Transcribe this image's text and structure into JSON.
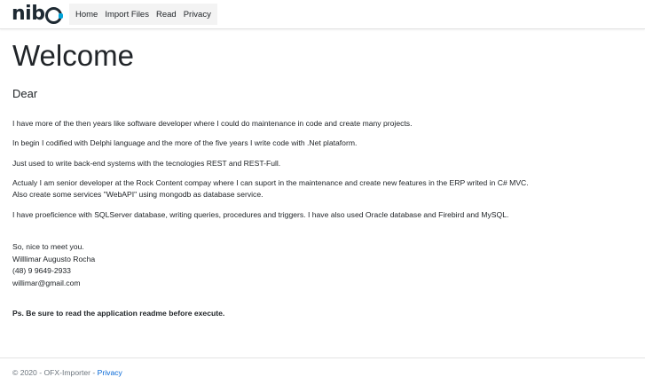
{
  "nav": {
    "brand": "nib",
    "links": [
      "Home",
      "Import Files",
      "Read",
      "Privacy"
    ]
  },
  "main": {
    "title": "Welcome",
    "greeting": "Dear",
    "paragraphs": [
      "I have more of the then years like software developer where I could do maintenance in code and create many projects.",
      "In begin I codified with Delphi language and the more of the five years I write code with .Net plataform.",
      "Just used to write back-end systems with the tecnologies REST and REST-Full.",
      "Actualy I am senior developer at the Rock Content compay where I can suport in the maintenance and create new features in the ERP writed in C# MVC.",
      "Also create some services \"WebAPI\" using mongodb as database service.",
      "I have proeficience with SQLServer database, writing queries, procedures and triggers. I have also used Oracle database and Firebird and MySQL."
    ],
    "signoff": {
      "line1": "So, nice to meet you.",
      "name": "Willlimar Augusto Rocha",
      "phone": "(48) 9 9649-2933",
      "email": "willimar@gmail.com"
    },
    "ps": "Ps. Be sure to read the application readme before execute."
  },
  "footer": {
    "copyright": "© 2020 - OFX-Importer - ",
    "privacy_link": "Privacy"
  },
  "colors": {
    "brand_dark": "#1e2a33",
    "brand_accent": "#00a3d9",
    "link": "#0366d6"
  }
}
